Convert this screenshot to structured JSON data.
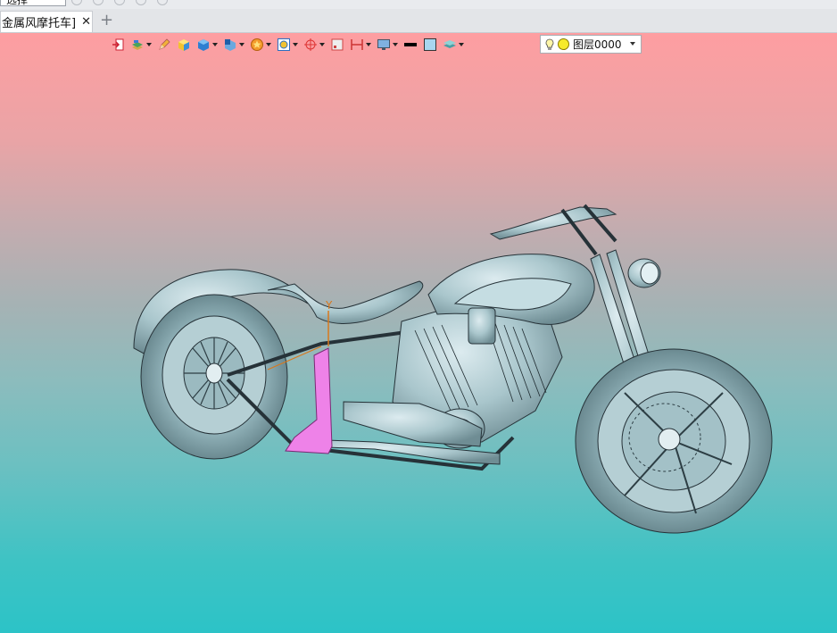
{
  "top_bar": {
    "selector_value": "选择"
  },
  "tabs": [
    {
      "label": "金属风摩托车]",
      "close": "✕"
    }
  ],
  "new_tab": "+",
  "toolbar": {
    "icons": [
      "import-icon",
      "layers-stack-icon",
      "pencil-icon",
      "shaded-cube-icon",
      "blue-cube-icon",
      "cube-view-icon",
      "star-render-icon",
      "frame-icon",
      "axis-cross-icon",
      "window-icon",
      "dimension-icon",
      "display-icon",
      "line-color-swatch-icon",
      "fill-color-swatch-icon",
      "layer-plane-icon"
    ],
    "layer_name": "图层0000"
  },
  "viewport": {
    "axis_label": "Y",
    "gradient_top": "#fe9ea1",
    "gradient_bottom": "#2cc3c7",
    "selection_color": "#ee82e8",
    "model_color": "#a9c6cc"
  }
}
